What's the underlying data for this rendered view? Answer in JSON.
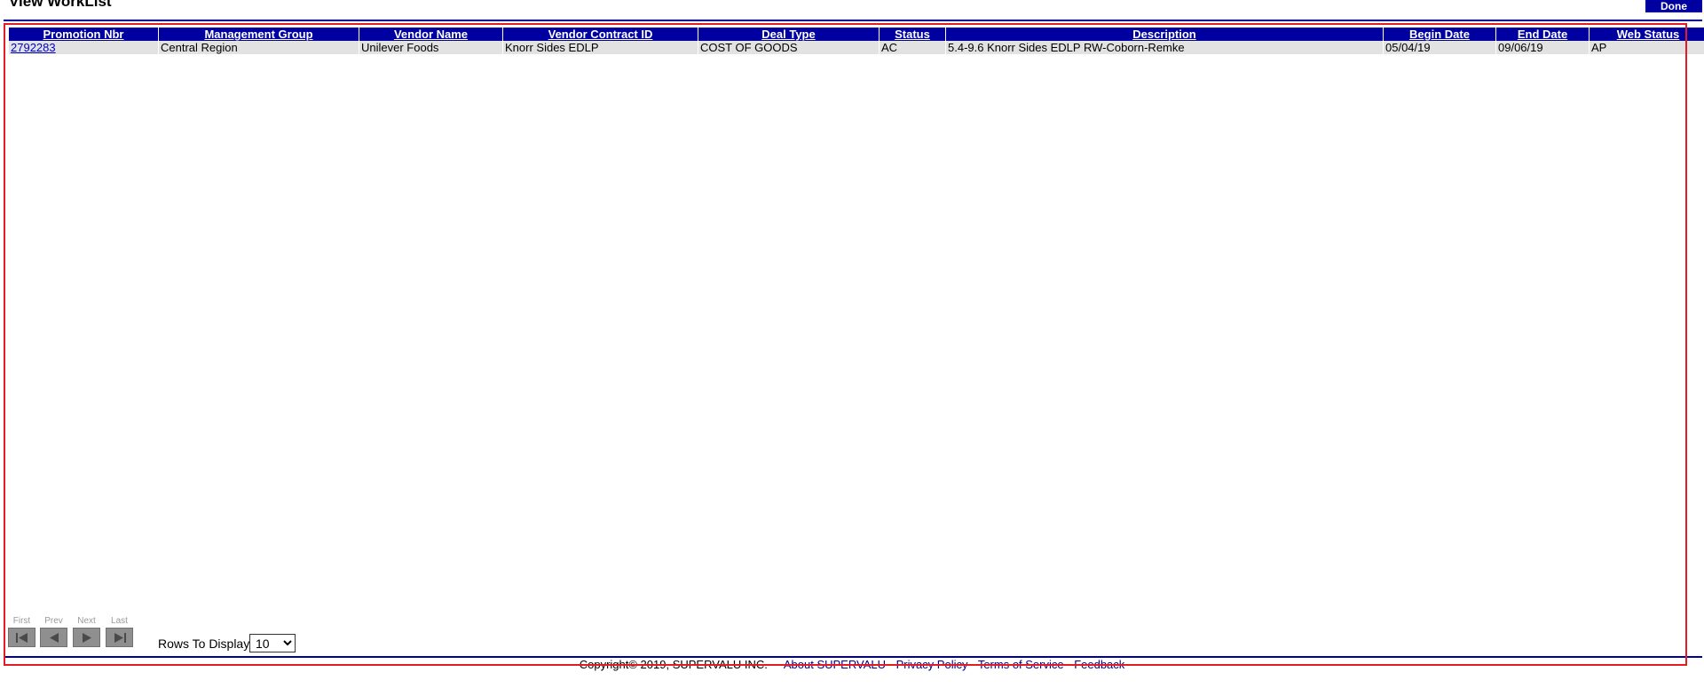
{
  "page": {
    "title": "View WorkList",
    "done_label": "Done"
  },
  "table": {
    "columns": [
      "Promotion Nbr",
      "Management Group",
      "Vendor Name",
      "Vendor Contract ID",
      "Deal Type",
      "Status",
      "Description",
      "Begin Date",
      "End Date",
      "Web Status"
    ],
    "rows": [
      {
        "promotion_nbr": "2792283",
        "management_group": "Central Region",
        "vendor_name": "Unilever Foods",
        "vendor_contract_id": "Knorr Sides EDLP",
        "deal_type": "COST OF GOODS",
        "status": "AC",
        "description": "5.4-9.6 Knorr Sides EDLP RW-Coborn-Remke",
        "begin_date": "05/04/19",
        "end_date": "09/06/19",
        "web_status": "AP"
      }
    ]
  },
  "pager": {
    "first_label": "First",
    "prev_label": "Prev",
    "next_label": "Next",
    "last_label": "Last",
    "icons": [
      "first-page-icon",
      "prev-page-icon",
      "next-page-icon",
      "last-page-icon"
    ],
    "rows_label": "Rows To Display",
    "rows_selected": "10"
  },
  "footer": {
    "copyright": "Copyright© 2019, SUPERVALU INC.",
    "links": [
      "About SUPERVALU",
      "Privacy Policy",
      "Terms of Service",
      "Feedback"
    ],
    "separator": " - "
  },
  "colors": {
    "header_bg": "#0000a0",
    "row_bg": "#e2e2e2",
    "frame": "#e31b23",
    "link": "#0000cc"
  }
}
